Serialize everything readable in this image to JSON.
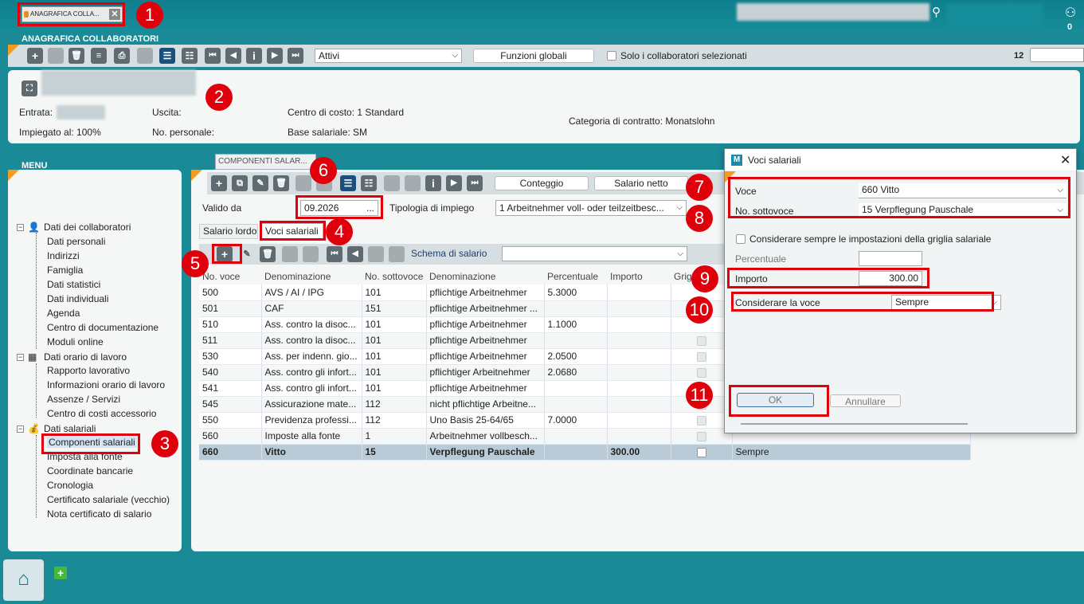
{
  "top": {
    "doc_tab": "ANAGRAFICA COLLA...",
    "notif_count": "0"
  },
  "header": {
    "section_title": "ANAGRAFICA COLLABORATORI",
    "filter_select": "Attivi",
    "global_functions": "Funzioni globali",
    "only_selected": "Solo i collaboratori selezionati",
    "record_count": "12"
  },
  "info": {
    "entrata": "Entrata:",
    "uscita": "Uscita:",
    "centro": "Centro di costo: 1 Standard",
    "impiegato": "Impiegato al: 100%",
    "no_personale": "No. personale:",
    "base": "Base salariale: SM",
    "categoria": "Categoria di contratto: Monatslohn"
  },
  "menu": {
    "title": "MENU",
    "groups": [
      {
        "label": "Dati dei collaboratori",
        "items": [
          "Dati personali",
          "Indirizzi",
          "Famiglia",
          "Dati statistici",
          "Dati individuali",
          "Agenda",
          "Centro di documentazione",
          "Moduli online"
        ]
      },
      {
        "label": "Dati orario di lavoro",
        "items": [
          "Rapporto lavorativo",
          "Informazioni orario di lavoro",
          "Assenze / Servizi",
          "Centro di costi accessorio"
        ]
      },
      {
        "label": "Dati salariali",
        "items": [
          "Componenti salariali",
          "Imposta alla fonte",
          "Coordinate bancarie",
          "Cronologia",
          "Certificato salariale (vecchio)",
          "Nota certificato di salario"
        ]
      }
    ]
  },
  "components": {
    "tab": "COMPONENTI SALAR...",
    "conteggio": "Conteggio",
    "salario_netto": "Salario netto",
    "valido_da_label": "Valido da",
    "valido_da_value": "09.2026",
    "tipologia_label": "Tipologia di impiego",
    "tipologia_value": "1 Arbeitnehmer voll- oder teilzeitbesc...",
    "subtab1": "Salario lordo",
    "subtab2": "Voci salariali",
    "schema_label": "Schema di salario"
  },
  "table": {
    "headers": [
      "No. voce",
      "Denominazione",
      "No. sottovoce",
      "Denominazione",
      "Percentuale",
      "Importo",
      "Grig"
    ],
    "rows": [
      [
        "500",
        "AVS / AI / IPG",
        "101",
        "pflichtige Arbeitnehmer",
        "5.3000",
        "",
        ""
      ],
      [
        "501",
        "CAF",
        "151",
        "pflichtige Arbeitnehmer ...",
        "",
        "",
        ""
      ],
      [
        "510",
        "Ass. contro la disoc...",
        "101",
        "pflichtige Arbeitnehmer",
        "1.1000",
        "",
        ""
      ],
      [
        "511",
        "Ass. contro la disoc...",
        "101",
        "pflichtige Arbeitnehmer",
        "",
        "",
        ""
      ],
      [
        "530",
        "Ass. per indenn. gio...",
        "101",
        "pflichtige Arbeitnehmer",
        "2.0500",
        "",
        ""
      ],
      [
        "540",
        "Ass. contro gli infort...",
        "101",
        "pflichtiger Arbeitnehmer",
        "2.0680",
        "",
        ""
      ],
      [
        "541",
        "Ass. contro gli infort...",
        "101",
        "pflichtige Arbeitnehmer",
        "",
        "",
        ""
      ],
      [
        "545",
        "Assicurazione mate...",
        "112",
        "nicht pflichtige Arbeitne...",
        "",
        "",
        ""
      ],
      [
        "550",
        "Previdenza professi...",
        "112",
        "Uno Basis 25-64/65",
        "7.0000",
        "",
        ""
      ],
      [
        "560",
        "Imposte alla fonte",
        "1",
        "Arbeitnehmer vollbesch...",
        "",
        "",
        ""
      ],
      [
        "660",
        "Vitto",
        "15",
        "Verpflegung Pauschale",
        "",
        "300.00",
        ""
      ]
    ],
    "last_row_extra": "Sempre"
  },
  "dialog": {
    "title": "Voci salariali",
    "voce_label": "Voce",
    "voce_value": "660 Vitto",
    "sottovoce_label": "No. sottovoce",
    "sottovoce_value": "15 Verpflegung Pauschale",
    "always_label": "Considerare sempre le impostazioni della griglia salariale",
    "percentuale_label": "Percentuale",
    "importo_label": "Importo",
    "importo_value": "300.00",
    "considerare_label": "Considerare la voce",
    "considerare_value": "Sempre",
    "ok": "OK",
    "cancel": "Annullare"
  },
  "badges": [
    "1",
    "2",
    "3",
    "4",
    "5",
    "6",
    "7",
    "8",
    "9",
    "10",
    "11"
  ],
  "colors": {
    "teal": "#1a8a96",
    "highlight": "#e0000b",
    "selected_row": "#b9cbd6"
  }
}
